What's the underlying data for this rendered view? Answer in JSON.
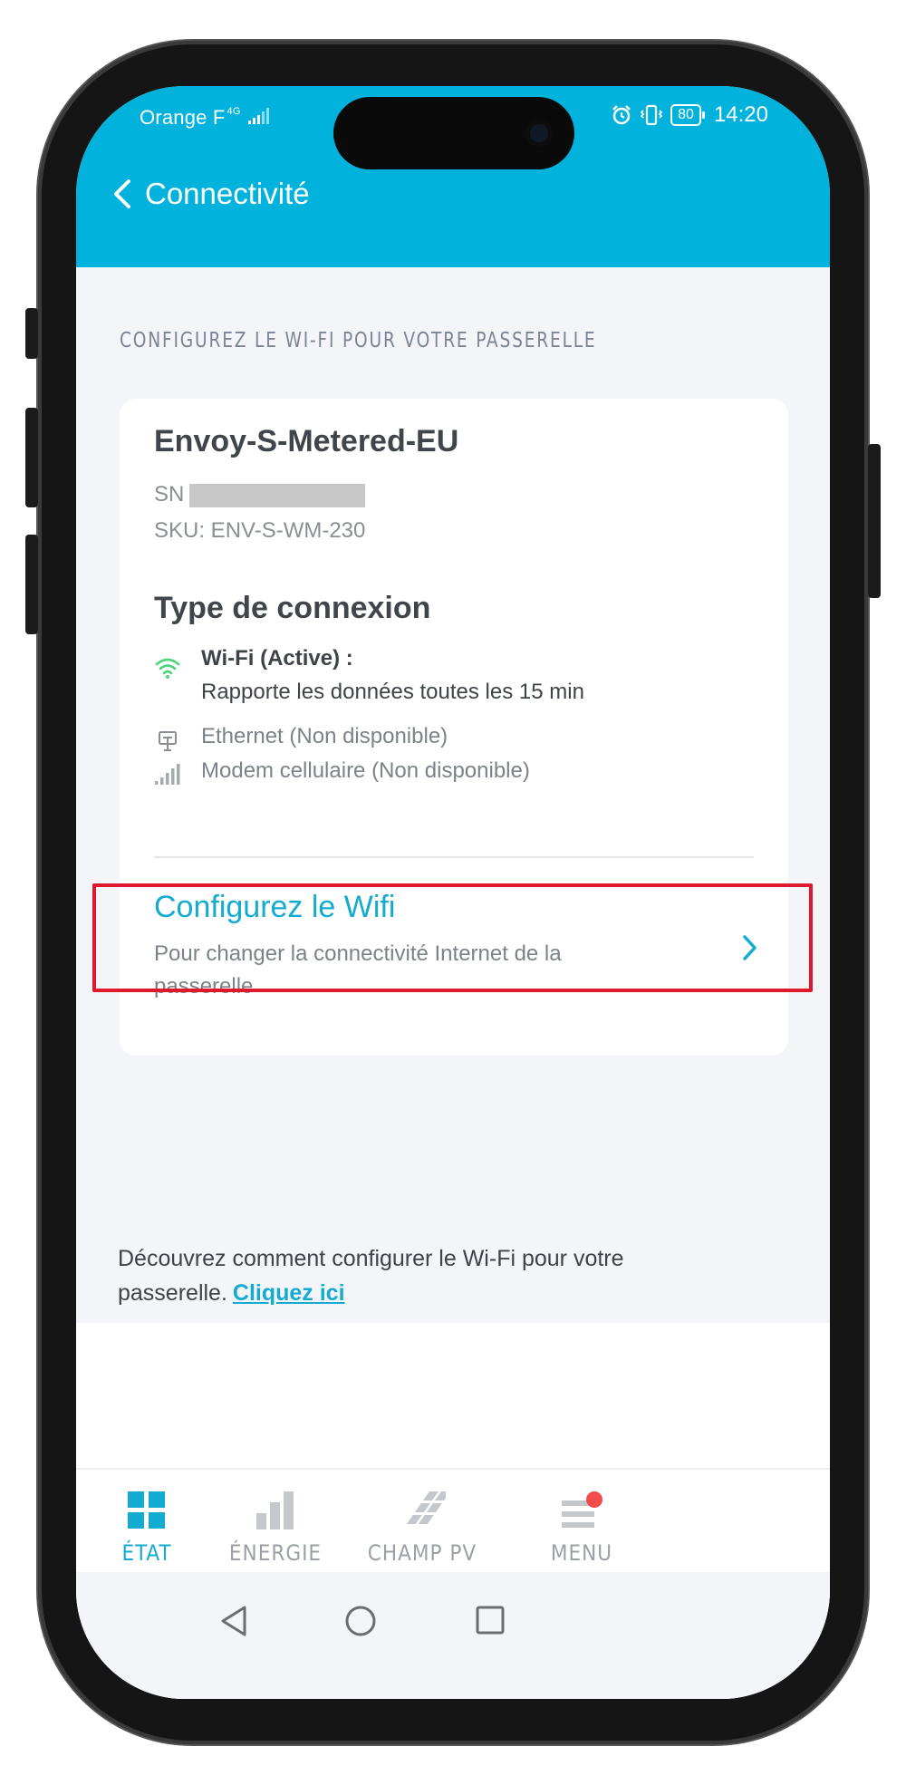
{
  "status_bar": {
    "carrier": "Orange F",
    "network_type": "4G",
    "battery": "80",
    "time": "14:20"
  },
  "header": {
    "title": "Connectivité"
  },
  "section_label": "CONFIGUREZ LE WI-FI POUR VOTRE PASSERELLE",
  "device": {
    "name": "Envoy-S-Metered-EU",
    "sn_label": "SN",
    "sku": "SKU: ENV-S-WM-230"
  },
  "connection": {
    "title": "Type de connexion",
    "wifi_label": "Wi-Fi (Active) :",
    "wifi_detail": "Rapporte les données toutes les 15 min",
    "ethernet": "Ethernet (Non disponible)",
    "cellular": "Modem cellulaire (Non disponible)"
  },
  "configure": {
    "title": "Configurez le Wifi",
    "description": "Pour changer la connectivité Internet de la passerelle"
  },
  "help": {
    "text": "Découvrez comment configurer le Wi-Fi pour votre passerelle.",
    "link": "Cliquez ici"
  },
  "tabs": [
    {
      "label": "ÉTAT",
      "icon": "grid-icon",
      "active": true
    },
    {
      "label": "ÉNERGIE",
      "icon": "bar-chart-icon",
      "active": false
    },
    {
      "label": "CHAMP PV",
      "icon": "solar-panel-icon",
      "active": false
    },
    {
      "label": "MENU",
      "icon": "menu-icon",
      "active": false
    }
  ],
  "colors": {
    "accent": "#00b2dc",
    "accent_text": "#14abd0",
    "highlight": "#e0182e",
    "notification": "#f24b4b",
    "wifi_green": "#4cd37b"
  }
}
